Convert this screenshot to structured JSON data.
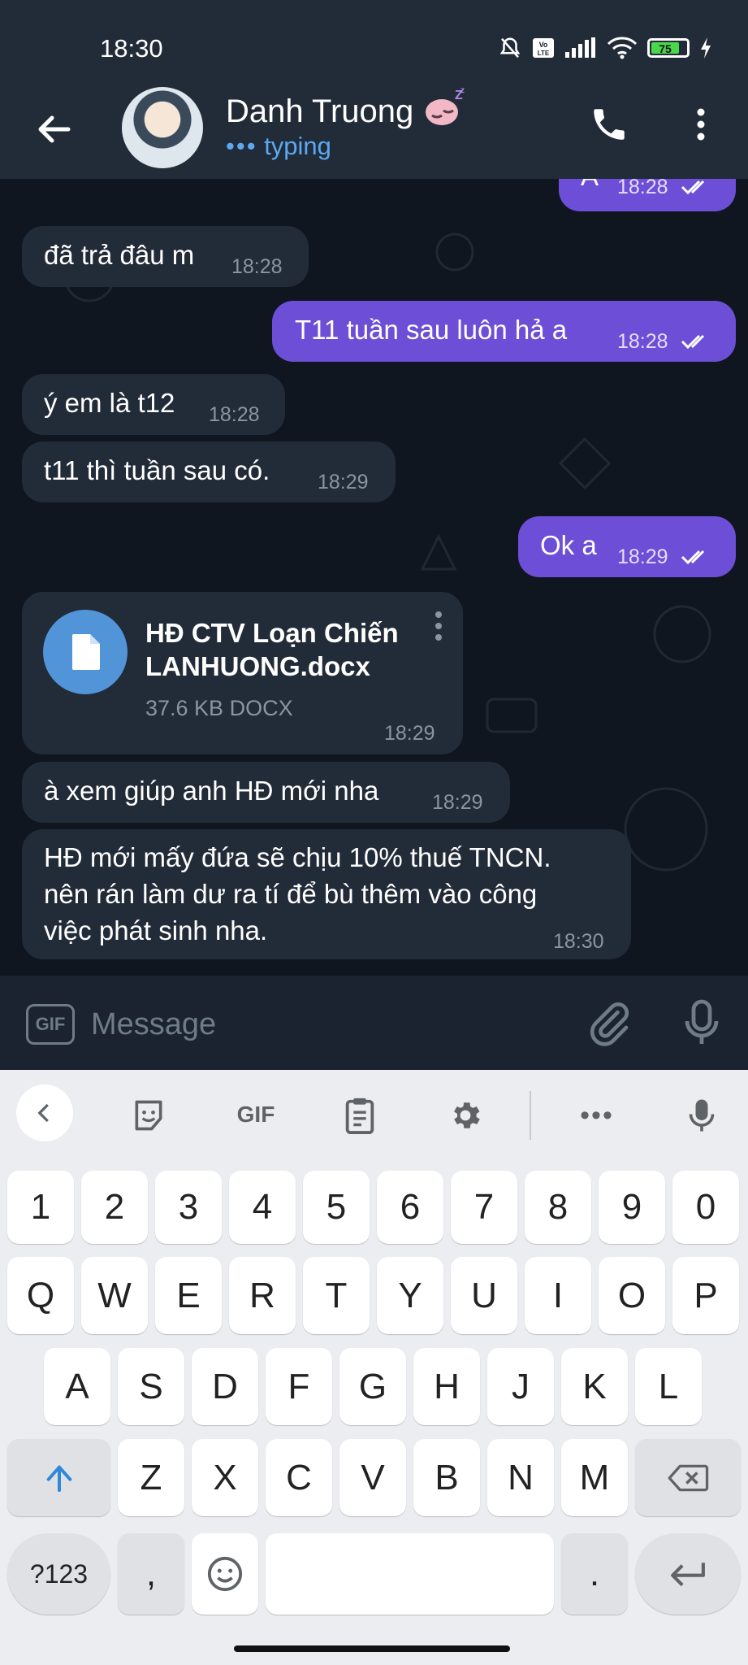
{
  "status": {
    "time": "18:30",
    "battery": "75"
  },
  "header": {
    "name": "Danh Truong",
    "status": "typing"
  },
  "messages": [
    {
      "text": "A",
      "time": "18:28",
      "out": true
    },
    {
      "text": "đã trả đâu m",
      "time": "18:28",
      "out": false
    },
    {
      "text": "T11 tuần sau luôn hả a",
      "time": "18:28",
      "out": true
    },
    {
      "text": "ý em là t12",
      "time": "18:28",
      "out": false
    },
    {
      "text": "t11 thì tuần sau có.",
      "time": "18:29",
      "out": false
    },
    {
      "text": "Ok a",
      "time": "18:29",
      "out": true
    },
    {
      "file_name_line1": "HĐ CTV Loạn Chiến",
      "file_name_line2": "LANHUONG.docx",
      "file_meta": "37.6 KB DOCX",
      "time": "18:29",
      "out": false
    },
    {
      "text": "à xem giúp anh HĐ mới nha",
      "time": "18:29",
      "out": false
    },
    {
      "line1": "HĐ mới mấy đứa sẽ chịu 10% thuế TNCN.",
      "line2": "nên rán làm dư ra tí để bù thêm vào công",
      "line3": "việc phát sinh nha.",
      "time": "18:30",
      "out": false
    }
  ],
  "input": {
    "placeholder": "Message",
    "gif_label": "GIF"
  },
  "keyboard": {
    "toolbar_gif": "GIF",
    "row_numbers": [
      "1",
      "2",
      "3",
      "4",
      "5",
      "6",
      "7",
      "8",
      "9",
      "0"
    ],
    "row1": [
      "Q",
      "W",
      "E",
      "R",
      "T",
      "Y",
      "U",
      "I",
      "O",
      "P"
    ],
    "row2": [
      "A",
      "S",
      "D",
      "F",
      "G",
      "H",
      "J",
      "K",
      "L"
    ],
    "row3": [
      "Z",
      "X",
      "C",
      "V",
      "B",
      "N",
      "M"
    ],
    "sym": "?123",
    "comma": ",",
    "period": "."
  }
}
